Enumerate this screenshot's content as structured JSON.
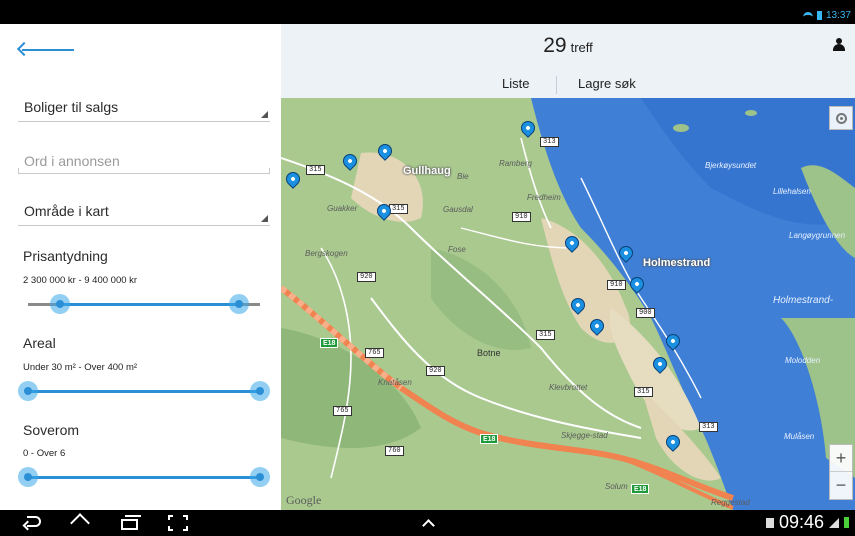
{
  "status_bar": {
    "time": "13:37"
  },
  "left_panel": {
    "property_type": "Boliger til salgs",
    "keyword_placeholder": "Ord i annonsen",
    "area_select": "Område i kart",
    "price": {
      "title": "Prisantydning",
      "range": "2 300 000 kr - 9 400 000 kr",
      "low_fraction": 0.14,
      "high_fraction": 0.91
    },
    "size": {
      "title": "Areal",
      "range": "Under 30 m² - Over 400 m²",
      "low_fraction": 0.0,
      "high_fraction": 1.0
    },
    "bedrooms": {
      "title": "Soverom",
      "range": "0 - Over 6",
      "low_fraction": 0.0,
      "high_fraction": 1.0
    }
  },
  "header": {
    "hit_count": "29",
    "hit_label": "treff",
    "tab_list": "Liste",
    "tab_save_search": "Lagre søk"
  },
  "map": {
    "places": {
      "gullhaug": "Gullhaug",
      "holmestrand": "Holmestrand",
      "botne": "Botne",
      "ramberg": "Ramberg",
      "fredheim": "Fredheim",
      "gausdal": "Gausdal",
      "guakker": "Guakker",
      "bergskogen": "Bergskogen",
      "fose": "Fose",
      "kristtasen": "Knatåsen",
      "klevbrottet": "Klevbrottet",
      "skjegge": "Skjegge-stad",
      "solumo": "Solum",
      "reggestad": "Reggestad",
      "bie": "Bie",
      "molodden": "Molodden",
      "mulasen": "Mulåsen",
      "langoygrunnen": "Langøygrunnen",
      "bjerkoysundet": "Bjerkøysundet",
      "lillehalsen": "Lillehalsen",
      "holmestrandfjorden": "Holmestrand-"
    },
    "roads": [
      "313",
      "315",
      "315",
      "910",
      "920",
      "910",
      "900",
      "765",
      "920",
      "315",
      "315",
      "765",
      "760",
      "313"
    ],
    "e18": "E18",
    "attribution": "Google",
    "zoom_in": "+",
    "zoom_out": "−",
    "marker_count": 16
  },
  "nav_bar": {
    "time": "09:46"
  }
}
